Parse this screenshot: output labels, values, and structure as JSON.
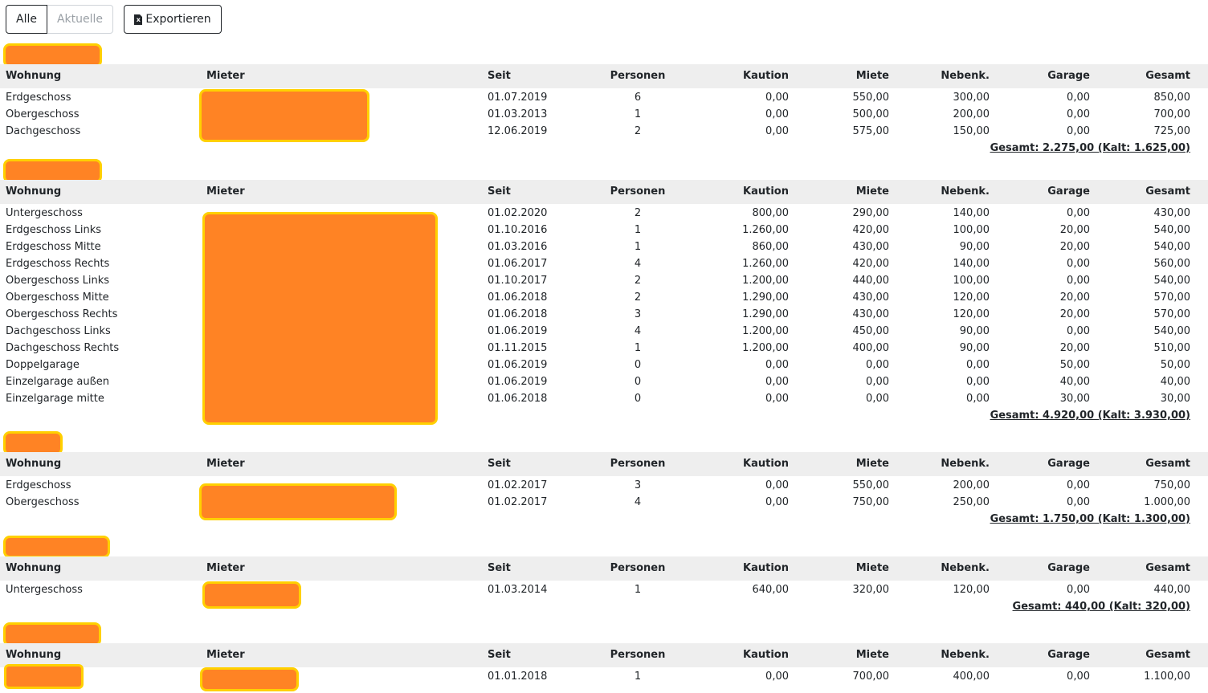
{
  "toolbar": {
    "filter_all": "Alle",
    "filter_current": "Aktuelle",
    "export_label": "Exportieren",
    "export_icon": "excel-file-icon"
  },
  "columns": {
    "wohnung": "Wohnung",
    "mieter": "Mieter",
    "seit": "Seit",
    "personen": "Personen",
    "kaution": "Kaution",
    "miete": "Miete",
    "nebenk": "Nebenk.",
    "garage": "Garage",
    "gesamt": "Gesamt"
  },
  "colors": {
    "redaction_fill": "#ff8324",
    "redaction_border": "#ffd000",
    "header_bg": "#eeeeee"
  },
  "properties": [
    {
      "total": "Gesamt: 2.275,00 (Kalt: 1.625,00)",
      "rows": [
        [
          "Erdgeschoss",
          "01.07.2019",
          "6",
          "0,00",
          "550,00",
          "300,00",
          "0,00",
          "850,00"
        ],
        [
          "Obergeschoss",
          "01.03.2013",
          "1",
          "0,00",
          "500,00",
          "200,00",
          "0,00",
          "700,00"
        ],
        [
          "Dachgeschoss",
          "12.06.2019",
          "2",
          "0,00",
          "575,00",
          "150,00",
          "0,00",
          "725,00"
        ]
      ]
    },
    {
      "total": "Gesamt: 4.920,00 (Kalt: 3.930,00)",
      "rows": [
        [
          "Untergeschoss",
          "01.02.2020",
          "2",
          "800,00",
          "290,00",
          "140,00",
          "0,00",
          "430,00"
        ],
        [
          "Erdgeschoss Links",
          "01.10.2016",
          "1",
          "1.260,00",
          "420,00",
          "100,00",
          "20,00",
          "540,00"
        ],
        [
          "Erdgeschoss Mitte",
          "01.03.2016",
          "1",
          "860,00",
          "430,00",
          "90,00",
          "20,00",
          "540,00"
        ],
        [
          "Erdgeschoss Rechts",
          "01.06.2017",
          "4",
          "1.260,00",
          "420,00",
          "140,00",
          "0,00",
          "560,00"
        ],
        [
          "Obergeschoss Links",
          "01.10.2017",
          "2",
          "1.200,00",
          "440,00",
          "100,00",
          "0,00",
          "540,00"
        ],
        [
          "Obergeschoss Mitte",
          "01.06.2018",
          "2",
          "1.290,00",
          "430,00",
          "120,00",
          "20,00",
          "570,00"
        ],
        [
          "Obergeschoss Rechts",
          "01.06.2018",
          "3",
          "1.290,00",
          "430,00",
          "120,00",
          "20,00",
          "570,00"
        ],
        [
          "Dachgeschoss Links",
          "01.06.2019",
          "4",
          "1.200,00",
          "450,00",
          "90,00",
          "0,00",
          "540,00"
        ],
        [
          "Dachgeschoss Rechts",
          "01.11.2015",
          "1",
          "1.200,00",
          "400,00",
          "90,00",
          "20,00",
          "510,00"
        ],
        [
          "Doppelgarage",
          "01.06.2019",
          "0",
          "0,00",
          "0,00",
          "0,00",
          "50,00",
          "50,00"
        ],
        [
          "Einzelgarage außen",
          "01.06.2019",
          "0",
          "0,00",
          "0,00",
          "0,00",
          "40,00",
          "40,00"
        ],
        [
          "Einzelgarage mitte",
          "01.06.2018",
          "0",
          "0,00",
          "0,00",
          "0,00",
          "30,00",
          "30,00"
        ]
      ]
    },
    {
      "total": "Gesamt: 1.750,00 (Kalt: 1.300,00)",
      "rows": [
        [
          "Erdgeschoss",
          "01.02.2017",
          "3",
          "0,00",
          "550,00",
          "200,00",
          "0,00",
          "750,00"
        ],
        [
          "Obergeschoss",
          "01.02.2017",
          "4",
          "0,00",
          "750,00",
          "250,00",
          "0,00",
          "1.000,00"
        ]
      ]
    },
    {
      "total": "Gesamt: 440,00 (Kalt: 320,00)",
      "rows": [
        [
          "Untergeschoss",
          "01.03.2014",
          "1",
          "640,00",
          "320,00",
          "120,00",
          "0,00",
          "440,00"
        ]
      ]
    },
    {
      "total": "",
      "rows": [
        [
          "",
          "01.01.2018",
          "1",
          "0,00",
          "700,00",
          "400,00",
          "0,00",
          "1.100,00"
        ]
      ]
    }
  ]
}
